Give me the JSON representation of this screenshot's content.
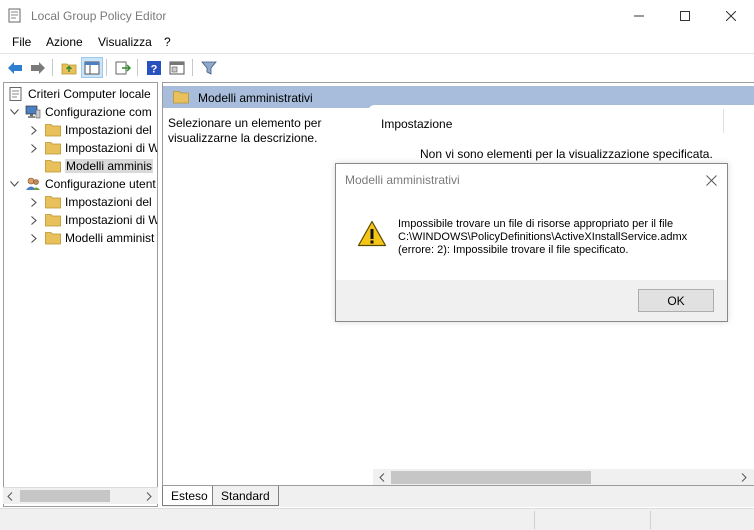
{
  "window": {
    "title": "Local Group Policy Editor"
  },
  "menu": [
    "File",
    "Azione",
    "Visualizza",
    "?"
  ],
  "tree": {
    "root": "Criteri Computer locale",
    "computer_config": "Configurazione com",
    "computer_children": [
      "Impostazioni del",
      "Impostazioni di W",
      "Modelli amminis"
    ],
    "user_config": "Configurazione utent",
    "user_children": [
      "Impostazioni del",
      "Impostazioni di W",
      "Modelli amminist"
    ]
  },
  "right_pane": {
    "header": "Modelli amministrativi",
    "description": "Selezionare un elemento per visualizzarne la descrizione.",
    "column": "Impostazione",
    "empty_text": "Non vi sono elementi per la visualizzazione specificata."
  },
  "tabs": [
    "Esteso",
    "Standard"
  ],
  "dialog": {
    "title": "Modelli amministrativi",
    "line1": "Impossibile trovare un file di risorse appropriato per il file",
    "line2": "C:\\WINDOWS\\PolicyDefinitions\\ActiveXInstallService.admx",
    "line3": "(errore: 2): Impossibile trovare il file specificato.",
    "ok_label": "OK"
  },
  "icons": {
    "app": "policy-editor-icon",
    "warning": "warning-icon",
    "folder": "folder-icon"
  },
  "colors": {
    "header_bg": "#a7bddb",
    "selected_tree": "#d9d9d9",
    "folder": "#e8c15d",
    "back_arrow": "#2f7fd0",
    "warning_yellow": "#f5c518"
  }
}
